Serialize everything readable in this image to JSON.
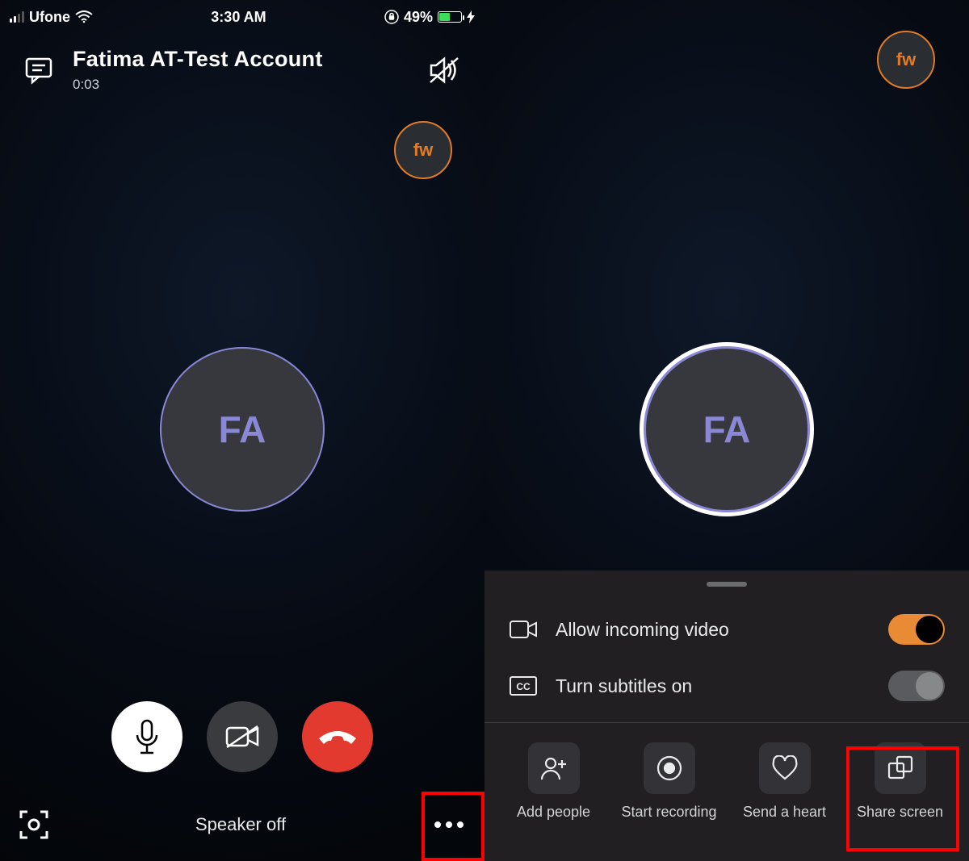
{
  "status": {
    "carrier": "Ufone",
    "time": "3:30 AM",
    "battery_pct": "49%"
  },
  "call": {
    "name": "Fatima AT-Test Account",
    "duration": "0:03",
    "speaker_label": "Speaker off"
  },
  "avatars": {
    "self_initials": "fw",
    "remote_initials": "FA"
  },
  "sheet": {
    "allow_video_label": "Allow incoming video",
    "subtitles_label": "Turn subtitles on",
    "actions": {
      "add_people": "Add people",
      "start_recording": "Start recording",
      "send_heart": "Send a heart",
      "share_screen": "Share screen"
    }
  }
}
